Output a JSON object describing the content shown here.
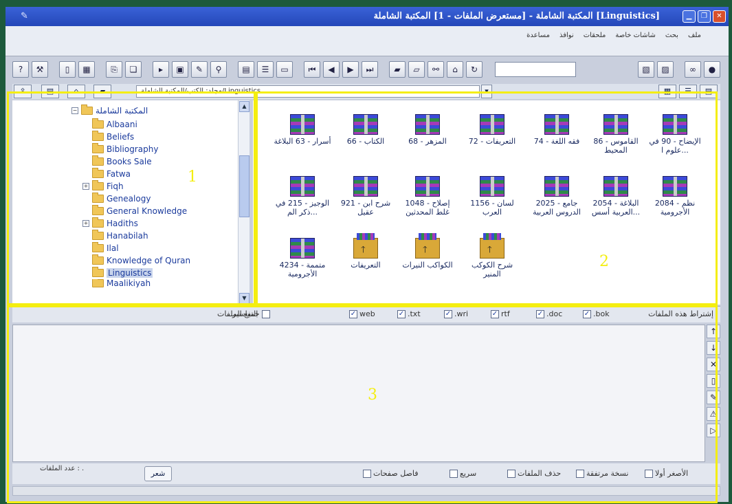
{
  "window": {
    "title": "[Linguistics] المكتبة الشاملة - [مستعرض الملفات - 1] المكتبة الشاملة"
  },
  "menu": [
    "ملف",
    "بحث",
    "شاشات خاصة",
    "ملحقات",
    "نوافذ",
    "مساعدة"
  ],
  "path": "مجلد: الكتب/المكتبة الشاملة/Linguistics",
  "tree": {
    "root": "المكتبة الشاملة",
    "items": [
      "Albaani",
      "Beliefs",
      "Bibliography",
      "Books Sale",
      "Fatwa",
      "Fiqh",
      "Genealogy",
      "General Knowledge",
      "Hadiths",
      "Hanabilah",
      "Ilal",
      "Knowledge of Quran",
      "Linguistics",
      "Maalikiyah"
    ]
  },
  "files": [
    "الإيضاح - 90 في علوم ا...",
    "القاموس - 86 المحيط",
    "فقه اللغة - 74",
    "التعريفات - 72",
    "المزهر - 68",
    "الكتاب - 66",
    "أسرار - 63 البلاغة",
    "نظم - 2084 الأجرومية",
    "البلاغة - 2054 العربية أسس...",
    "جامع - 2025 الدروس العربية",
    "لسان - 1156 العرب",
    "إصلاح - 1048 غلط المحدثين",
    "شرح ابن - 921 عقيل",
    "الوجيز - 215 في ذكر الم...",
    "متممة - 4234 الأجرومية",
    "التعريفات",
    "الكواكب النيرات",
    "شرح الكوكب المنير"
  ],
  "options": {
    "label_right": "إشتراط هذه الملفات",
    "types": [
      ".bok",
      ".doc",
      "rtf",
      ".wri",
      ".txt",
      "web"
    ],
    "all_files": "جميع الملفات",
    "tafaseer": "التفاسير"
  },
  "bottom": {
    "count_label": "عدد الملفات : .",
    "poetry_button": "شعر",
    "checks": [
      "الأصغر أولا",
      "نسخة مرتفقة",
      "حذف الملفات",
      "سريع",
      "فاصل صفحات"
    ]
  },
  "regions": [
    "1",
    "2",
    "3"
  ],
  "colors": {
    "highlight": "#f4ee10",
    "titlebar": "#2447b8"
  }
}
